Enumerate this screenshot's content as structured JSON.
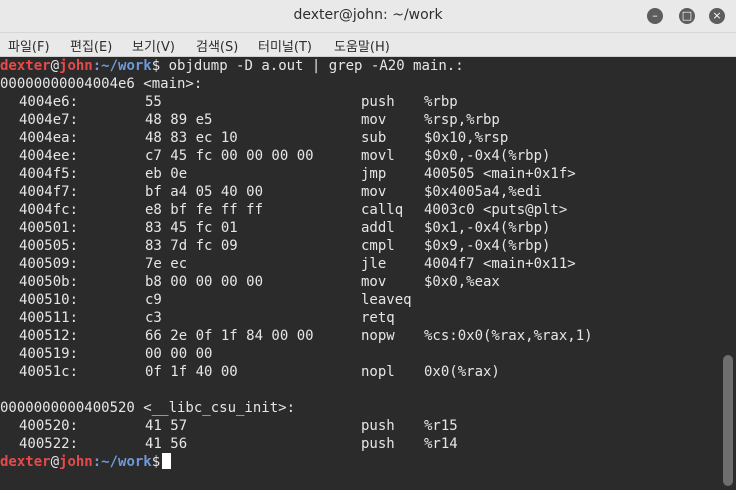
{
  "window": {
    "title": "dexter@john: ~/work",
    "controls": {
      "minimize": "–",
      "maximize": "□",
      "close": "×"
    }
  },
  "menu": [
    "파일(F)",
    "편집(E)",
    "보기(V)",
    "검색(S)",
    "터미널(T)",
    "도움말(H)"
  ],
  "prompt": {
    "user": "dexter",
    "at": "@",
    "host": "john",
    "path": ":~/work",
    "dollar": "$"
  },
  "command": " objdump -D a.out | grep -A20 main.:",
  "main_label": "00000000004004e6 <main>:",
  "main_rows": [
    {
      "addr": "4004e6:",
      "bytes": "55",
      "op": "push",
      "args": "%rbp"
    },
    {
      "addr": "4004e7:",
      "bytes": "48 89 e5",
      "op": "mov",
      "args": "%rsp,%rbp"
    },
    {
      "addr": "4004ea:",
      "bytes": "48 83 ec 10",
      "op": "sub",
      "args": "$0x10,%rsp"
    },
    {
      "addr": "4004ee:",
      "bytes": "c7 45 fc 00 00 00 00",
      "op": "movl",
      "args": "$0x0,-0x4(%rbp)"
    },
    {
      "addr": "4004f5:",
      "bytes": "eb 0e",
      "op": "jmp",
      "args": "400505 <main+0x1f>"
    },
    {
      "addr": "4004f7:",
      "bytes": "bf a4 05 40 00",
      "op": "mov",
      "args": "$0x4005a4,%edi"
    },
    {
      "addr": "4004fc:",
      "bytes": "e8 bf fe ff ff",
      "op": "callq",
      "args": "4003c0 <puts@plt>"
    },
    {
      "addr": "400501:",
      "bytes": "83 45 fc 01",
      "op": "addl",
      "args": "$0x1,-0x4(%rbp)"
    },
    {
      "addr": "400505:",
      "bytes": "83 7d fc 09",
      "op": "cmpl",
      "args": "$0x9,-0x4(%rbp)"
    },
    {
      "addr": "400509:",
      "bytes": "7e ec",
      "op": "jle",
      "args": "4004f7 <main+0x11>"
    },
    {
      "addr": "40050b:",
      "bytes": "b8 00 00 00 00",
      "op": "mov",
      "args": "$0x0,%eax"
    },
    {
      "addr": "400510:",
      "bytes": "c9",
      "op": "leaveq",
      "args": ""
    },
    {
      "addr": "400511:",
      "bytes": "c3",
      "op": "retq",
      "args": ""
    },
    {
      "addr": "400512:",
      "bytes": "66 2e 0f 1f 84 00 00",
      "op": "nopw",
      "args": "%cs:0x0(%rax,%rax,1)"
    },
    {
      "addr": "400519:",
      "bytes": "00 00 00",
      "op": "",
      "args": ""
    },
    {
      "addr": "40051c:",
      "bytes": "0f 1f 40 00",
      "op": "nopl",
      "args": "0x0(%rax)"
    }
  ],
  "init_label": "0000000000400520 <__libc_csu_init>:",
  "init_rows": [
    {
      "addr": "400520:",
      "bytes": "41 57",
      "op": "push",
      "args": "%r15"
    },
    {
      "addr": "400522:",
      "bytes": "41 56",
      "op": "push",
      "args": "%r14"
    }
  ]
}
